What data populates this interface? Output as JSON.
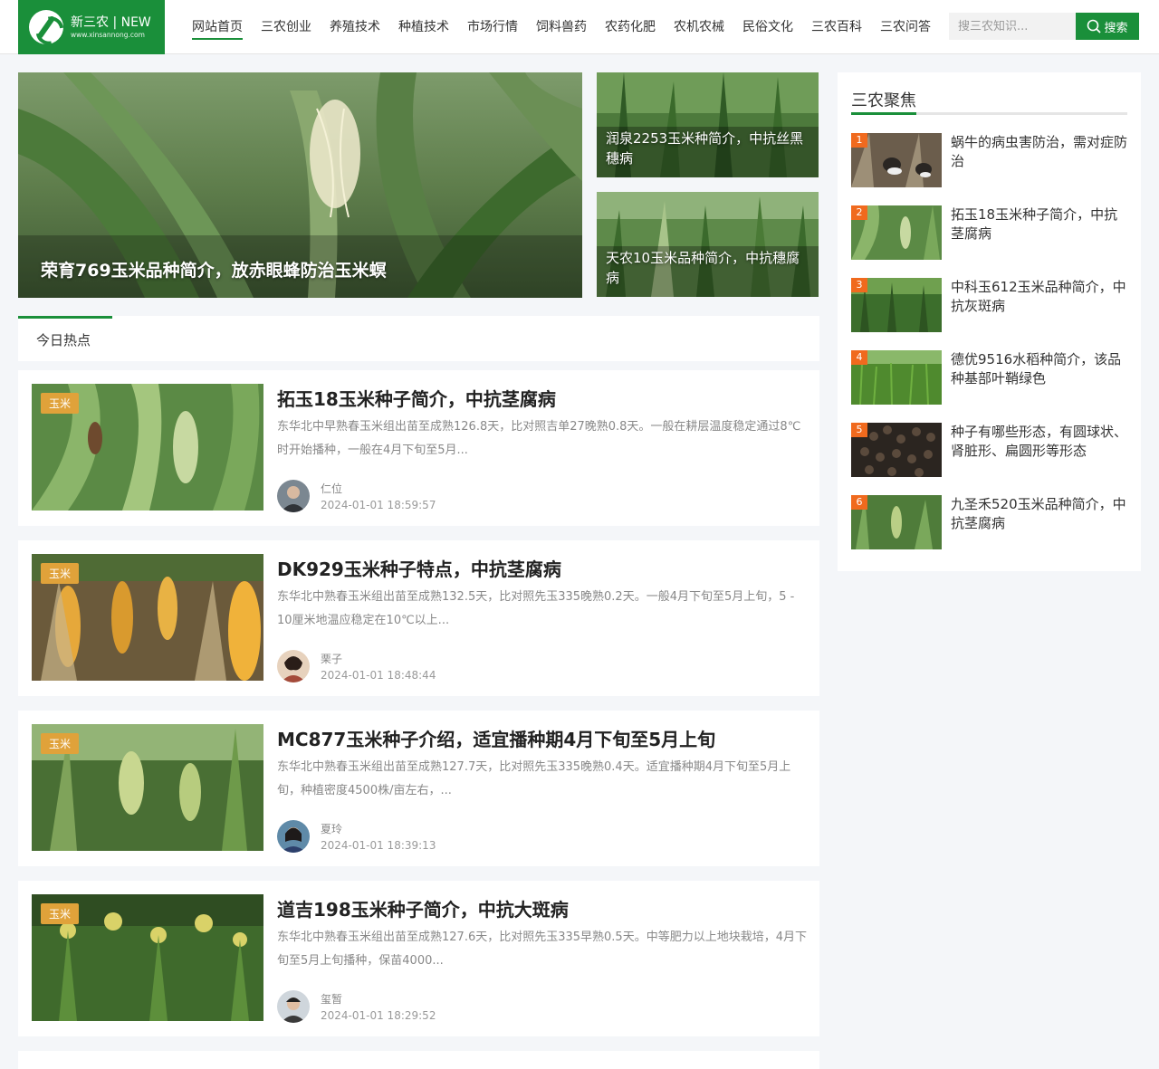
{
  "logo": {
    "title": "新三农 | NEW",
    "url": "www.xinsannong.com"
  },
  "nav": {
    "items": [
      {
        "label": "网站首页"
      },
      {
        "label": "三农创业"
      },
      {
        "label": "养殖技术"
      },
      {
        "label": "种植技术"
      },
      {
        "label": "市场行情"
      },
      {
        "label": "饲料兽药"
      },
      {
        "label": "农药化肥"
      },
      {
        "label": "农机农械"
      },
      {
        "label": "民俗文化"
      },
      {
        "label": "三农百科"
      },
      {
        "label": "三农问答"
      }
    ]
  },
  "search": {
    "placeholder": "搜三农知识...",
    "button_label": "搜索"
  },
  "hero": {
    "main_title": "荣育769玉米品种简介，放赤眼蜂防治玉米螟",
    "side": [
      {
        "title": "润泉2253玉米种简介，中抗丝黑穗病"
      },
      {
        "title": "天农10玉米品种简介，中抗穗腐病"
      }
    ]
  },
  "hot": {
    "title": "今日热点"
  },
  "articles": [
    {
      "tag": "玉米",
      "title": "拓玉18玉米种子简介，中抗茎腐病",
      "excerpt": "东华北中早熟春玉米组出苗至成熟126.8天，比对照吉单27晚熟0.8天。一般在耕层温度稳定通过8℃时开始播种，一般在4月下旬至5月...",
      "author": "仁位",
      "date": "2024-01-01 18:59:57"
    },
    {
      "tag": "玉米",
      "title": "DK929玉米种子特点，中抗茎腐病",
      "excerpt": "东华北中熟春玉米组出苗至成熟132.5天，比对照先玉335晚熟0.2天。一般4月下旬至5月上旬，5 - 10厘米地温应稳定在10℃以上...",
      "author": "栗子",
      "date": "2024-01-01 18:48:44"
    },
    {
      "tag": "玉米",
      "title": "MC877玉米种子介绍，适宜播种期4月下旬至5月上旬",
      "excerpt": "东华北中熟春玉米组出苗至成熟127.7天，比对照先玉335晚熟0.4天。适宜播种期4月下旬至5月上旬，种植密度4500株/亩左右，...",
      "author": "夏玲",
      "date": "2024-01-01 18:39:13"
    },
    {
      "tag": "玉米",
      "title": "道吉198玉米种子简介，中抗大斑病",
      "excerpt": "东华北中熟春玉米组出苗至成熟127.6天，比对照先玉335早熟0.5天。中等肥力以上地块栽培，4月下旬至5月上旬播种，保苗4000...",
      "author": "玺暂",
      "date": "2024-01-01 18:29:52"
    }
  ],
  "sidebar": {
    "title": "三农聚焦",
    "items": [
      {
        "rank": "1",
        "text": "蜗牛的病虫害防治，需对症防治"
      },
      {
        "rank": "2",
        "text": "拓玉18玉米种子简介，中抗茎腐病"
      },
      {
        "rank": "3",
        "text": "中科玉612玉米品种简介，中抗灰斑病"
      },
      {
        "rank": "4",
        "text": "德优9516水稻种简介，该品种基部叶鞘绿色"
      },
      {
        "rank": "5",
        "text": "种子有哪些形态，有圆球状、肾脏形、扁圆形等形态"
      },
      {
        "rank": "6",
        "text": "九圣禾520玉米品种简介，中抗茎腐病"
      }
    ]
  },
  "colors": {
    "brand": "#1a8f3a",
    "tag": "#e0a23a",
    "rank": "#f06a1e"
  }
}
